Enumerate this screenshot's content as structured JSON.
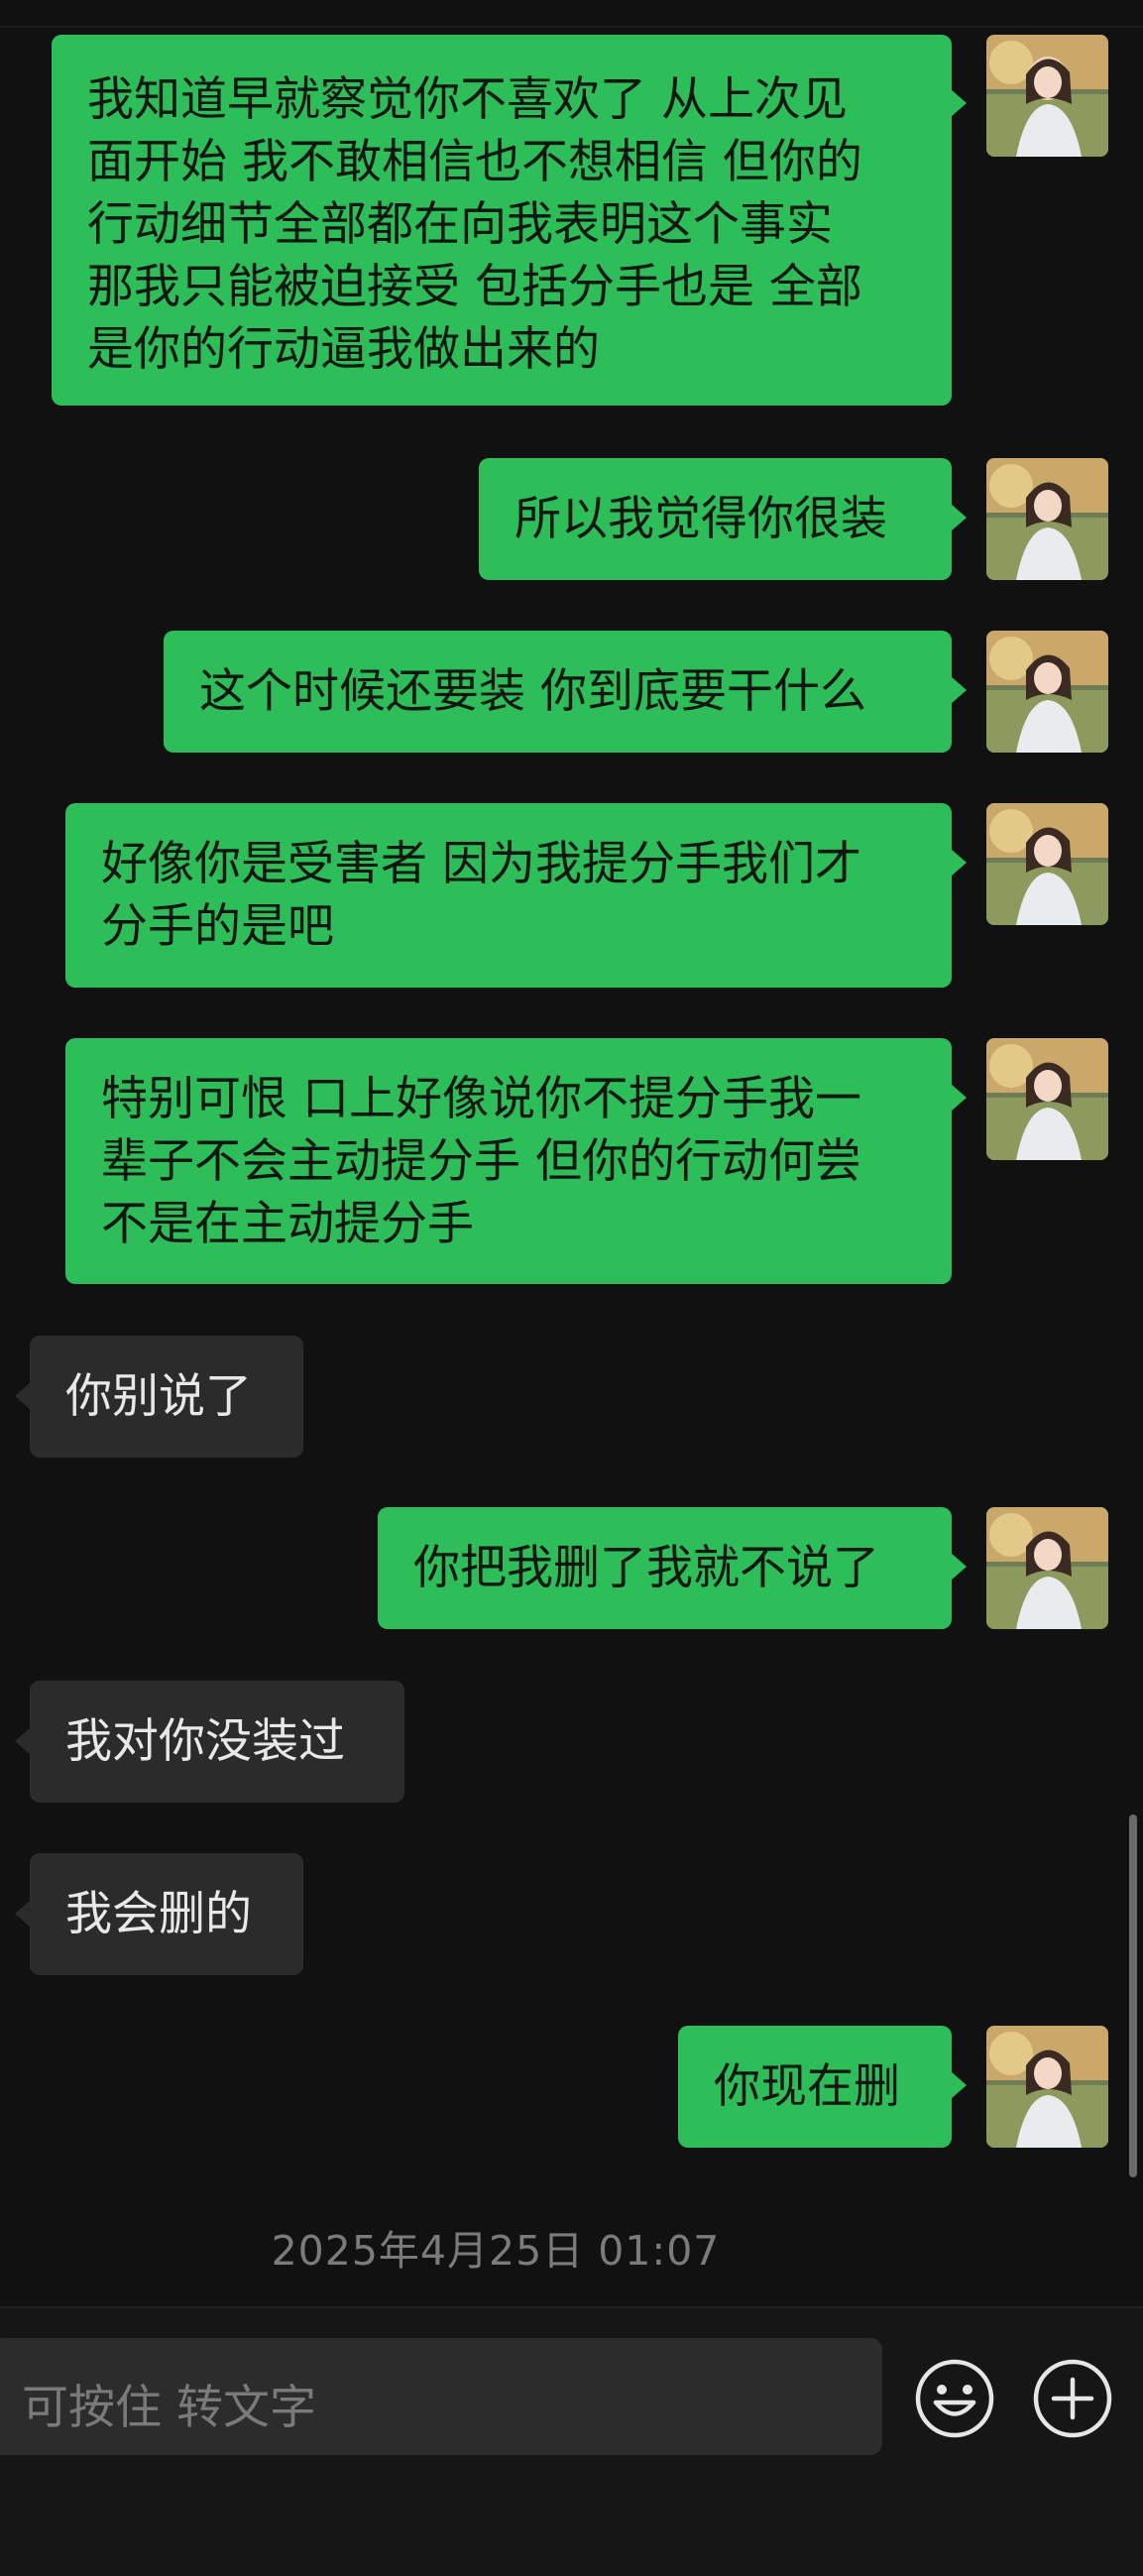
{
  "messages": [
    {
      "side": "out",
      "text": "我知道早就察觉你不喜欢了 从上次见\n面开始 我不敢相信也不想相信 但你的\n行动细节全部都在向我表明这个事实\n那我只能被迫接受 包括分手也是 全部\n是你的行动逼我做出来的"
    },
    {
      "side": "out",
      "text": "所以我觉得你很装"
    },
    {
      "side": "out",
      "text": "这个时候还要装 你到底要干什么"
    },
    {
      "side": "out",
      "text": "好像你是受害者 因为我提分手我们才\n分手的是吧"
    },
    {
      "side": "out",
      "text": "特别可恨 口上好像说你不提分手我一\n辈子不会主动提分手 但你的行动何尝\n不是在主动提分手"
    },
    {
      "side": "in",
      "text": "你别说了"
    },
    {
      "side": "out",
      "text": "你把我删了我就不说了"
    },
    {
      "side": "in",
      "text": "我对你没装过"
    },
    {
      "side": "in",
      "text": "我会删的"
    },
    {
      "side": "out",
      "text": "你现在删"
    }
  ],
  "timestamp": "2025年4月25日 01:07",
  "input": {
    "placeholder": "可按住 转文字"
  },
  "icons": {
    "emoji": "emoji-icon",
    "plus": "plus-icon"
  },
  "colors": {
    "background": "#111111",
    "outgoing_bubble": "#2bbe59",
    "incoming_bubble": "#2b2b2b",
    "timestamp": "#7b7b7b"
  }
}
